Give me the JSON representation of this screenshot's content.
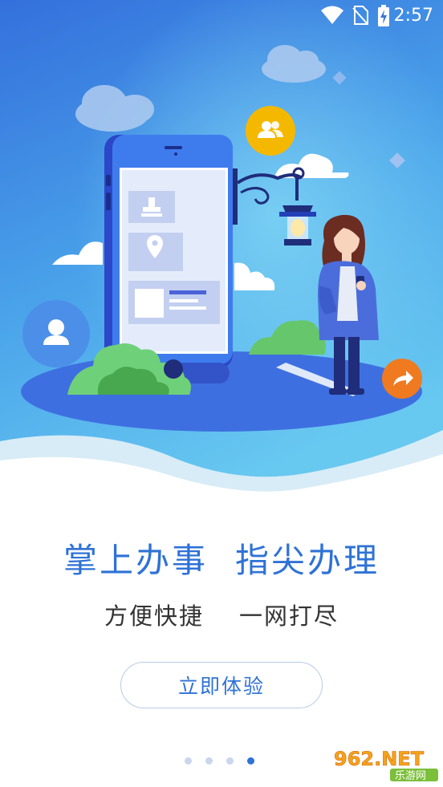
{
  "status_bar": {
    "time": "2:57",
    "icons": [
      "wifi-icon",
      "no-sim-icon",
      "battery-charging-icon"
    ]
  },
  "hero": {
    "icons": [
      "user-group-icon",
      "user-icon",
      "share-icon",
      "location-pin-icon",
      "stamp-icon",
      "moon-icon",
      "street-lamp-icon"
    ]
  },
  "headline": {
    "part1": "掌上办事",
    "part2": "指尖办理"
  },
  "subline": {
    "part1": "方便快捷",
    "part2": "一网打尽"
  },
  "cta": {
    "label": "立即体验"
  },
  "pager": {
    "total": 4,
    "active_index": 3
  },
  "watermark": {
    "text_top": "962.NET",
    "text_bottom": "乐游网"
  },
  "colors": {
    "accent": "#2f72d6",
    "sky_top": "#3a7de0",
    "sky_bottom": "#5cc3ee",
    "orange": "#f07a1f",
    "yellow": "#f5b800",
    "green": "#5fc05a"
  }
}
